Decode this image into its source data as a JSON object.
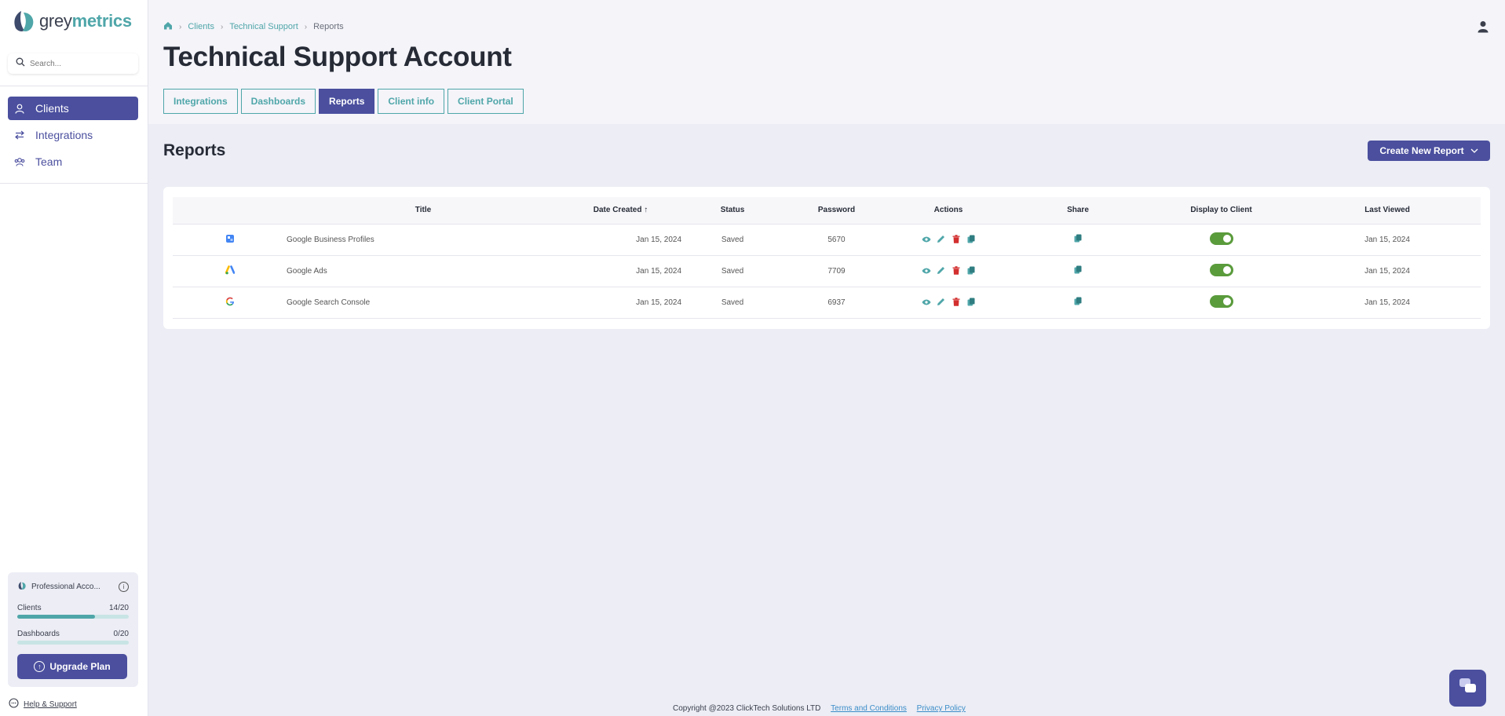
{
  "brand": {
    "grey": "grey",
    "metrics": "metrics",
    "accent": "#4fa6a9",
    "primary": "#4b4f9e"
  },
  "search": {
    "placeholder": "Search..."
  },
  "sidebar": {
    "items": [
      {
        "label": "Clients",
        "icon": "user-icon",
        "active": true
      },
      {
        "label": "Integrations",
        "icon": "arrows-swap-icon",
        "active": false
      },
      {
        "label": "Team",
        "icon": "team-icon",
        "active": false
      }
    ]
  },
  "plan": {
    "name": "Professional Acco...",
    "clients_label": "Clients",
    "clients_count": "14/20",
    "clients_fraction": 0.7,
    "dashboards_label": "Dashboards",
    "dashboards_count": "0/20",
    "dashboards_fraction": 0,
    "upgrade_label": "Upgrade Plan"
  },
  "help": {
    "label": "Help & Support"
  },
  "breadcrumb": [
    "Clients",
    "Technical Support",
    "Reports"
  ],
  "page": {
    "title": "Technical Support Account"
  },
  "tabs": [
    {
      "label": "Integrations",
      "active": false
    },
    {
      "label": "Dashboards",
      "active": false
    },
    {
      "label": "Reports",
      "active": true
    },
    {
      "label": "Client info",
      "active": false
    },
    {
      "label": "Client Portal",
      "active": false
    }
  ],
  "section": {
    "title": "Reports",
    "create_label": "Create New Report"
  },
  "table": {
    "headers": {
      "title": "Title",
      "date_created": "Date Created",
      "status": "Status",
      "password": "Password",
      "actions": "Actions",
      "share": "Share",
      "display": "Display to Client",
      "last_viewed": "Last Viewed"
    },
    "rows": [
      {
        "icon": "google-business-icon",
        "title": "Google Business Profiles",
        "date": "Jan 15, 2024",
        "status": "Saved",
        "password": "5670",
        "display": true,
        "last_viewed": "Jan 15, 2024"
      },
      {
        "icon": "google-ads-icon",
        "title": "Google Ads",
        "date": "Jan 15, 2024",
        "status": "Saved",
        "password": "7709",
        "display": true,
        "last_viewed": "Jan 15, 2024"
      },
      {
        "icon": "google-search-console-icon",
        "title": "Google Search Console",
        "date": "Jan 15, 2024",
        "status": "Saved",
        "password": "6937",
        "display": true,
        "last_viewed": "Jan 15, 2024"
      }
    ]
  },
  "footer": {
    "copyright": "Copyright @2023 ClickTech Solutions LTD",
    "terms": "Terms and Conditions",
    "privacy": "Privacy Policy"
  }
}
